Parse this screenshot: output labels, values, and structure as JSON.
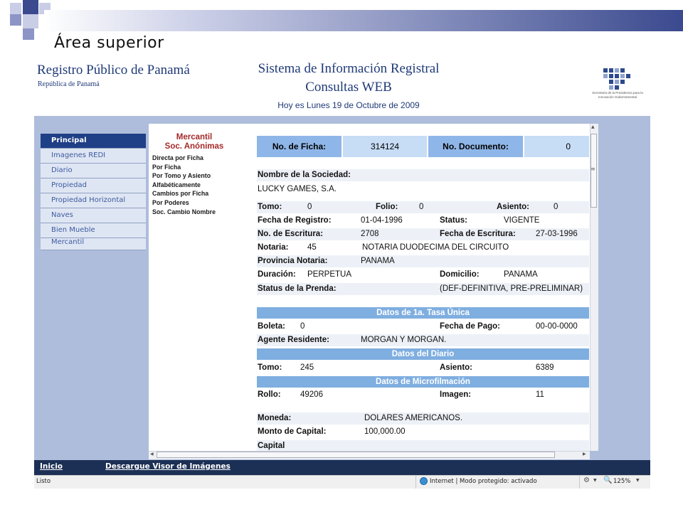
{
  "slide": {
    "title": "Área superior"
  },
  "site": {
    "left_title": "Registro Público de Panamá",
    "left_subtitle": "República de Panamá",
    "center_title_1": "Sistema de Información Registral",
    "center_title_2": "Consultas WEB",
    "date_text": "Hoy es Lunes 19 de Octubre de 2009",
    "logo_caption": "Secretaría de la Presidencia para la Innovación Gubernamental"
  },
  "nav": {
    "items": [
      {
        "label": "Principal",
        "active": true
      },
      {
        "label": "Imagenes REDI"
      },
      {
        "label": "Diario"
      },
      {
        "label": "Propiedad"
      },
      {
        "label": "Propiedad Horizontal"
      },
      {
        "label": "Naves"
      },
      {
        "label": "Bien Mueble"
      },
      {
        "label": "Mercantil"
      }
    ]
  },
  "submenu": {
    "heading_1": "Mercantil",
    "heading_2": "Soc. Anónimas",
    "links": [
      "Directa por Ficha",
      "Por Ficha",
      "Por Tomo y Asiento",
      "Alfabéticamente",
      "Cambios por Ficha",
      "Por Poderes",
      "Soc. Cambio Nombre"
    ]
  },
  "record": {
    "ficha_label": "No. de Ficha:",
    "ficha_value": "314124",
    "documento_label": "No. Documento:",
    "documento_value": "0",
    "sociedad_label": "Nombre de la Sociedad:",
    "sociedad_value": "LUCKY GAMES, S.A.",
    "tomo_label": "Tomo:",
    "tomo_value": "0",
    "folio_label": "Folio:",
    "folio_value": "0",
    "asiento_label": "Asiento:",
    "asiento_value": "0",
    "fecha_registro_label": "Fecha de Registro:",
    "fecha_registro_value": "01-04-1996",
    "status_label": "Status:",
    "status_value": "VIGENTE",
    "escritura_label": "No. de Escritura:",
    "escritura_value": "2708",
    "fecha_escritura_label": "Fecha de Escritura:",
    "fecha_escritura_value": "27-03-1996",
    "notaria_label": "Notaria:",
    "notaria_value": "45",
    "notaria_name": "NOTARIA DUODECIMA DEL CIRCUITO",
    "provincia_label": "Provincia Notaria:",
    "provincia_value": "PANAMA",
    "duracion_label": "Duración:",
    "duracion_value": "PERPETUA",
    "domicilio_label": "Domicilio:",
    "domicilio_value": "PANAMA",
    "prenda_label": "Status de la Prenda:",
    "prenda_value": "(DEF-DEFINITIVA, PRE-PRELIMINAR)",
    "tasa_heading": "Datos de 1a. Tasa Única",
    "boleta_label": "Boleta:",
    "boleta_value": "0",
    "fecha_pago_label": "Fecha de Pago:",
    "fecha_pago_value": "00-00-0000",
    "agente_label": "Agente Residente:",
    "agente_value": "MORGAN Y MORGAN.",
    "diario_heading": "Datos del Diario",
    "diario_tomo_label": "Tomo:",
    "diario_tomo_value": "245",
    "diario_asiento_label": "Asiento:",
    "diario_asiento_value": "6389",
    "micro_heading": "Datos de Microfilmación",
    "rollo_label": "Rollo:",
    "rollo_value": "49206",
    "imagen_label": "Imagen:",
    "imagen_value": "11",
    "moneda_label": "Moneda:",
    "moneda_value": "DOLARES AMERICANOS.",
    "capital_monto_label": "Monto de Capital:",
    "capital_monto_value": "100,000.00",
    "capital_label": "Capital"
  },
  "footer": {
    "inicio": "Inicio",
    "descargue": "Descargue Visor de Imágenes"
  },
  "statusbar": {
    "left": "Listo",
    "zone": "Internet | Modo protegido: activado",
    "zoom": "125%"
  }
}
